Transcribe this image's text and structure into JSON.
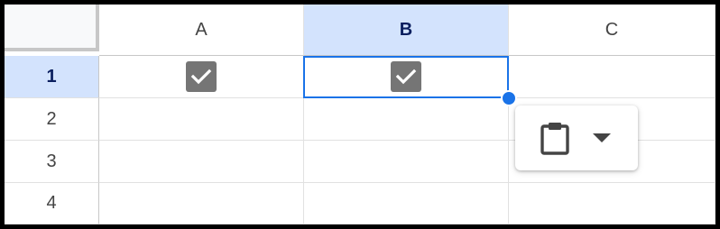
{
  "columns": [
    {
      "label": "A",
      "selected": false
    },
    {
      "label": "B",
      "selected": true
    },
    {
      "label": "C",
      "selected": false
    }
  ],
  "rows": [
    {
      "label": "1",
      "selected": true
    },
    {
      "label": "2",
      "selected": false
    },
    {
      "label": "3",
      "selected": false
    },
    {
      "label": "4",
      "selected": false
    }
  ],
  "cells": {
    "A1": {
      "type": "checkbox",
      "checked": true
    },
    "B1": {
      "type": "checkbox",
      "checked": true
    }
  },
  "selected_cell": "B1",
  "paste_popup": {
    "paste_icon": "clipboard-icon",
    "dropdown_icon": "caret-down-icon"
  },
  "colors": {
    "selection_accent": "#1a73e8",
    "header_selected_bg": "#d3e3fd",
    "checkbox_fill": "#757575"
  }
}
